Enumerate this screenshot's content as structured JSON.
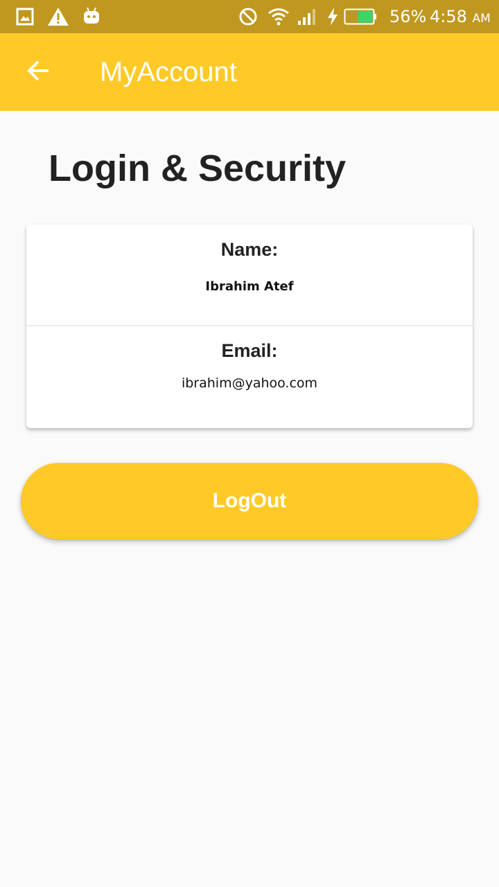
{
  "status_bar": {
    "icons": [
      "image-icon",
      "warning-icon",
      "android-icon",
      "do-not-disturb-icon",
      "wifi-icon",
      "signal-icon",
      "charging-icon",
      "battery-icon"
    ],
    "battery_percent": "56%",
    "battery_level": 0.56,
    "time": "4:58",
    "time_suffix": "AM",
    "background_color": "#c09820"
  },
  "app_bar": {
    "back_icon": "arrow-back-icon",
    "title": "MyAccount",
    "background_color": "#ffca28"
  },
  "page": {
    "heading": "Login & Security"
  },
  "account_card": {
    "name_label": "Name:",
    "name_value": "Ibrahim Atef",
    "email_label": "Email:",
    "email_value": "ibrahim@yahoo.com"
  },
  "logout_button": {
    "label": "LogOut",
    "color": "#ffca28"
  },
  "colors": {
    "accent": "#ffca28",
    "background": "#fafafa",
    "text_dark": "#222222"
  }
}
